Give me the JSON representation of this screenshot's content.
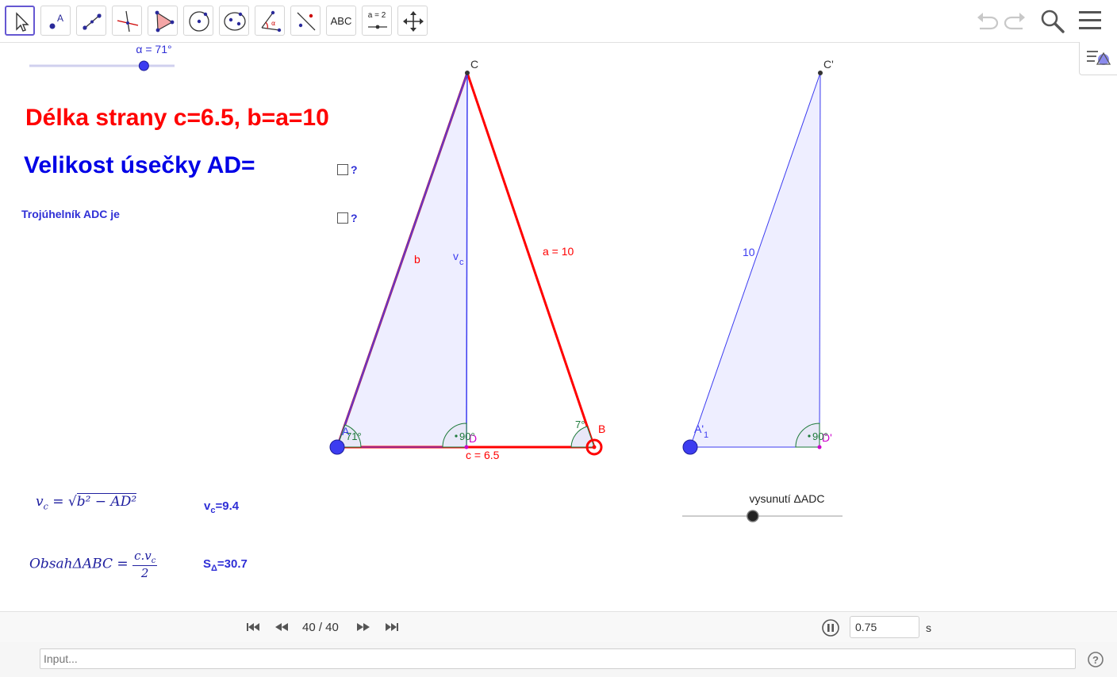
{
  "toolbar": {
    "tools": [
      {
        "name": "move-tool"
      },
      {
        "name": "point-tool"
      },
      {
        "name": "segment-tool"
      },
      {
        "name": "perpendicular-line-tool"
      },
      {
        "name": "polygon-tool"
      },
      {
        "name": "circle-tool"
      },
      {
        "name": "conic-tool"
      },
      {
        "name": "angle-tool"
      },
      {
        "name": "reflect-tool"
      },
      {
        "name": "text-tool",
        "label": "ABC"
      },
      {
        "name": "slider-tool",
        "label": "a = 2"
      },
      {
        "name": "move-graphics-view-tool"
      }
    ],
    "right_icons": [
      "undo-icon",
      "redo-icon",
      "search-icon",
      "menu-icon"
    ]
  },
  "slider_alpha": {
    "label": "α = 71°",
    "value": 71,
    "min": 0,
    "max": 90
  },
  "texts": {
    "title_red": "Délka strany c=6.5, b=a=10",
    "title_blue": "Velikost úsečky AD=",
    "triangle_text": "Trojúhelník ADC je",
    "checkbox_1": "?",
    "checkbox_2": "?"
  },
  "figure": {
    "point_A": "A",
    "point_B": "B",
    "point_C": "C",
    "point_D": "D",
    "point_C2": "C'",
    "point_A2": "A'",
    "point_A2_sub": "1",
    "point_D2": "D'",
    "label_b": "b",
    "label_vc": "v",
    "label_vc_sub": "c",
    "label_a": "a = 10",
    "label_c": "c = 6.5",
    "label_10": "10",
    "angle_A": "71°",
    "angle_D": "90°",
    "angle_B": "7°",
    "angle_D2": "90°"
  },
  "slider_shift": {
    "label": "vysunutí ΔADC",
    "value": 0.4
  },
  "formulas": {
    "vc_lhs": "v",
    "vc_lhs_sub": "c",
    "vc_eq": "=",
    "vc_root": "b² − AD²",
    "area_lhs": "ObsahΔABC =",
    "area_num": "c.v",
    "area_num_sub": "c",
    "area_den": "2"
  },
  "values": {
    "vc_label": "v",
    "vc_sub": "c",
    "vc_value": "=9.4",
    "area_label": "S",
    "area_sub": "Δ",
    "area_value": "=30.7"
  },
  "animation": {
    "frame": "40 / 40",
    "speed": "0.75",
    "unit": "s"
  },
  "input": {
    "placeholder": "Input..."
  },
  "colors": {
    "accent": "#6557d2",
    "red": "#ff0000",
    "blue": "#0000e6",
    "fill": "#eeeeff",
    "point_blue": "#3c3cf0"
  }
}
